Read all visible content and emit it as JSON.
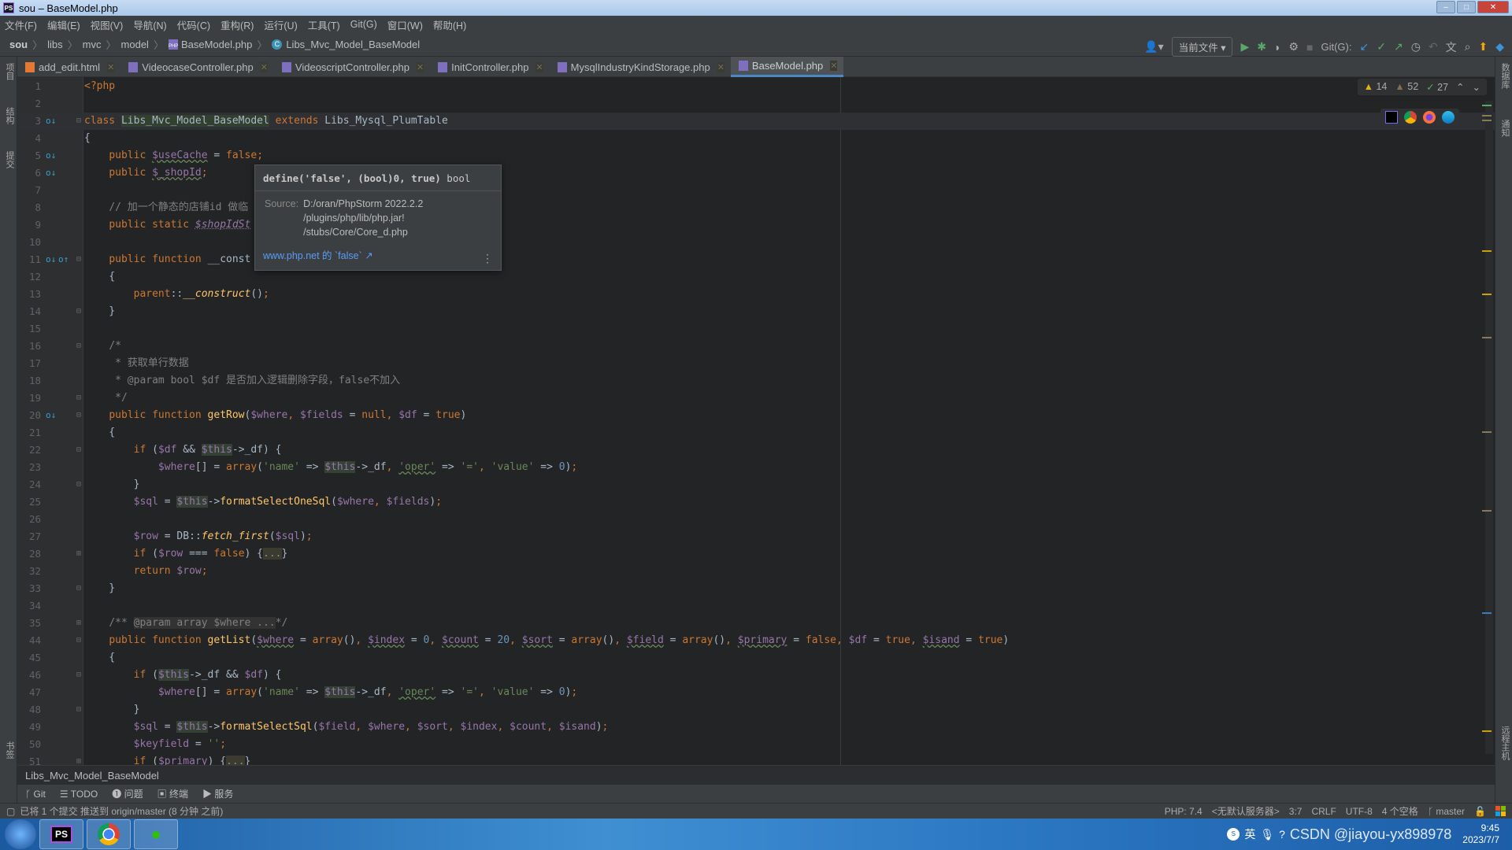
{
  "window": {
    "title": "sou – BaseModel.php"
  },
  "menu": [
    "文件(F)",
    "编辑(E)",
    "视图(V)",
    "导航(N)",
    "代码(C)",
    "重构(R)",
    "运行(U)",
    "工具(T)",
    "Git(G)",
    "窗口(W)",
    "帮助(H)"
  ],
  "breadcrumb": {
    "root": "sou",
    "parts": [
      "libs",
      "mvc",
      "model"
    ],
    "file": "BaseModel.php",
    "class": "Libs_Mvc_Model_BaseModel"
  },
  "toolbar": {
    "run_config": "当前文件",
    "git_label": "Git(G):"
  },
  "tabs": [
    {
      "label": "add_edit.html",
      "type": "html"
    },
    {
      "label": "VideocaseController.php",
      "type": "php"
    },
    {
      "label": "VideoscriptController.php",
      "type": "php"
    },
    {
      "label": "InitController.php",
      "type": "php"
    },
    {
      "label": "MysqlIndustryKindStorage.php",
      "type": "php"
    },
    {
      "label": "BaseModel.php",
      "type": "php",
      "active": true
    }
  ],
  "left_tools": [
    "项目",
    "结构",
    "提交",
    "书签"
  ],
  "right_tools": [
    "数据库",
    "通知",
    "远程主机"
  ],
  "inspections": {
    "warnings": "14",
    "weak_warnings": "52",
    "typos": "27"
  },
  "code": [
    {
      "n": "1",
      "t": [
        [
          "k",
          "<?php"
        ]
      ]
    },
    {
      "n": "2",
      "t": []
    },
    {
      "n": "3",
      "cur": true,
      "g": "o↓",
      "fold": "open",
      "t": [
        [
          "k",
          "class "
        ],
        [
          "hc",
          "Libs_Mvc_Model_BaseModel"
        ],
        [
          "k",
          " extends "
        ],
        [
          "",
          "Libs_Mysql_PlumTable"
        ]
      ]
    },
    {
      "n": "4",
      "t": [
        [
          "",
          "{"
        ]
      ]
    },
    {
      "n": "5",
      "g": "o↓",
      "t": [
        [
          "",
          "    "
        ],
        [
          "k",
          "public "
        ],
        [
          "v ul",
          "$useCache"
        ],
        [
          "",
          " = "
        ],
        [
          "k",
          "false"
        ],
        [
          "k",
          ";"
        ]
      ]
    },
    {
      "n": "6",
      "g": "o↓",
      "t": [
        [
          "",
          "    "
        ],
        [
          "k",
          "public "
        ],
        [
          "v ul",
          "$_shopId"
        ],
        [
          "k",
          ";"
        ]
      ]
    },
    {
      "n": "7",
      "t": []
    },
    {
      "n": "8",
      "t": [
        [
          "",
          "    "
        ],
        [
          "c",
          "// 加一个静态的店铺id 做临"
        ]
      ]
    },
    {
      "n": "9",
      "t": [
        [
          "",
          "    "
        ],
        [
          "k",
          "public static "
        ],
        [
          "vi",
          "$shopIdSt"
        ]
      ]
    },
    {
      "n": "10",
      "t": []
    },
    {
      "n": "11",
      "g": "o↓",
      "g2": "o↑",
      "fold": "open",
      "t": [
        [
          "",
          "    "
        ],
        [
          "k",
          "public function "
        ],
        [
          "",
          "__const"
        ]
      ]
    },
    {
      "n": "12",
      "t": [
        [
          "",
          "    {"
        ]
      ]
    },
    {
      "n": "13",
      "t": [
        [
          "",
          "        "
        ],
        [
          "k",
          "parent"
        ],
        [
          "",
          "::"
        ],
        [
          "fi",
          "__construct"
        ],
        [
          "",
          "()"
        ],
        [
          "k",
          ";"
        ]
      ]
    },
    {
      "n": "14",
      "fold": "close",
      "t": [
        [
          "",
          "    }"
        ]
      ]
    },
    {
      "n": "15",
      "t": []
    },
    {
      "n": "16",
      "fold": "open",
      "t": [
        [
          "",
          "    "
        ],
        [
          "c",
          "/*"
        ]
      ]
    },
    {
      "n": "17",
      "t": [
        [
          "c",
          "     * 获取单行数据"
        ]
      ]
    },
    {
      "n": "18",
      "t": [
        [
          "c",
          "     * @param bool $df 是否加入逻辑删除字段，false不加入"
        ]
      ]
    },
    {
      "n": "19",
      "fold": "close",
      "t": [
        [
          "c",
          "     */"
        ]
      ]
    },
    {
      "n": "20",
      "g": "o↓",
      "fold": "open",
      "t": [
        [
          "",
          "    "
        ],
        [
          "k",
          "public function "
        ],
        [
          "f",
          "getRow"
        ],
        [
          "",
          "("
        ],
        [
          "v",
          "$where"
        ],
        [
          "k",
          ", "
        ],
        [
          "v",
          "$fields"
        ],
        [
          "",
          " = "
        ],
        [
          "k",
          "null"
        ],
        [
          "k",
          ", "
        ],
        [
          "v",
          "$df"
        ],
        [
          "",
          " = "
        ],
        [
          "k",
          "true"
        ],
        [
          "",
          ")"
        ]
      ]
    },
    {
      "n": "21",
      "t": [
        [
          "",
          "    {"
        ]
      ]
    },
    {
      "n": "22",
      "fold": "open",
      "t": [
        [
          "",
          "        "
        ],
        [
          "k",
          "if "
        ],
        [
          "",
          "("
        ],
        [
          "v",
          "$df"
        ],
        [
          "",
          " && "
        ],
        [
          "h",
          "$this"
        ],
        [
          "",
          "->_df) {"
        ]
      ]
    },
    {
      "n": "23",
      "t": [
        [
          "",
          "            "
        ],
        [
          "v",
          "$where"
        ],
        [
          "",
          "[] = "
        ],
        [
          "k",
          "array"
        ],
        [
          "",
          "("
        ],
        [
          "s",
          "'name'"
        ],
        [
          "",
          " => "
        ],
        [
          "h",
          "$this"
        ],
        [
          "",
          "->_df"
        ],
        [
          "k",
          ", "
        ],
        [
          "s ul",
          "'oper'"
        ],
        [
          "",
          " => "
        ],
        [
          "s",
          "'='"
        ],
        [
          "k",
          ", "
        ],
        [
          "s",
          "'value'"
        ],
        [
          "",
          " => "
        ],
        [
          "n",
          "0"
        ],
        [
          "",
          ")"
        ],
        [
          "k",
          ";"
        ]
      ]
    },
    {
      "n": "24",
      "fold": "close",
      "t": [
        [
          "",
          "        }"
        ]
      ]
    },
    {
      "n": "25",
      "t": [
        [
          "",
          "        "
        ],
        [
          "v",
          "$sql"
        ],
        [
          "",
          " = "
        ],
        [
          "h",
          "$this"
        ],
        [
          "",
          "->"
        ],
        [
          "f",
          "formatSelectOneSql"
        ],
        [
          "",
          "("
        ],
        [
          "v",
          "$where"
        ],
        [
          "k",
          ", "
        ],
        [
          "v",
          "$fields"
        ],
        [
          "",
          ")"
        ],
        [
          "k",
          ";"
        ]
      ]
    },
    {
      "n": "26",
      "t": []
    },
    {
      "n": "27",
      "t": [
        [
          "",
          "        "
        ],
        [
          "v",
          "$row"
        ],
        [
          "",
          " = DB::"
        ],
        [
          "fi",
          "fetch_first"
        ],
        [
          "",
          "("
        ],
        [
          "v",
          "$sql"
        ],
        [
          "",
          ")"
        ],
        [
          "k",
          ";"
        ]
      ]
    },
    {
      "n": "28",
      "fold": "plus",
      "t": [
        [
          "",
          "        "
        ],
        [
          "k",
          "if "
        ],
        [
          "",
          "("
        ],
        [
          "v",
          "$row"
        ],
        [
          "",
          " === "
        ],
        [
          "k",
          "false"
        ],
        [
          "",
          ") {"
        ],
        [
          "x",
          "..."
        ],
        [
          "",
          "}"
        ]
      ]
    },
    {
      "n": "32",
      "t": [
        [
          "",
          "        "
        ],
        [
          "k",
          "return "
        ],
        [
          "v",
          "$row"
        ],
        [
          "k",
          ";"
        ]
      ]
    },
    {
      "n": "33",
      "fold": "close",
      "t": [
        [
          "",
          "    }"
        ]
      ]
    },
    {
      "n": "34",
      "t": []
    },
    {
      "n": "35",
      "fold": "plus",
      "t": [
        [
          "",
          "    "
        ],
        [
          "c",
          "/** "
        ],
        [
          "cx",
          "@param array $where ..."
        ],
        [
          "c",
          "*/"
        ]
      ]
    },
    {
      "n": "44",
      "fold": "open",
      "t": [
        [
          "",
          "    "
        ],
        [
          "k",
          "public function "
        ],
        [
          "f",
          "getList"
        ],
        [
          "",
          "("
        ],
        [
          "v ul",
          "$where"
        ],
        [
          "",
          " = "
        ],
        [
          "k",
          "array"
        ],
        [
          "",
          "()"
        ],
        [
          "k",
          ", "
        ],
        [
          "v ul",
          "$index"
        ],
        [
          "",
          " = "
        ],
        [
          "n",
          "0"
        ],
        [
          "k",
          ", "
        ],
        [
          "v ul",
          "$count"
        ],
        [
          "",
          " = "
        ],
        [
          "n",
          "20"
        ],
        [
          "k",
          ", "
        ],
        [
          "v ul",
          "$sort"
        ],
        [
          "",
          " = "
        ],
        [
          "k",
          "array"
        ],
        [
          "",
          "()"
        ],
        [
          "k",
          ", "
        ],
        [
          "v ul",
          "$field"
        ],
        [
          "",
          " = "
        ],
        [
          "k",
          "array"
        ],
        [
          "",
          "()"
        ],
        [
          "k",
          ", "
        ],
        [
          "v ul",
          "$primary"
        ],
        [
          "",
          " = "
        ],
        [
          "k",
          "false"
        ],
        [
          "k",
          ", "
        ],
        [
          "v",
          "$df"
        ],
        [
          "",
          " = "
        ],
        [
          "k",
          "true"
        ],
        [
          "k",
          ", "
        ],
        [
          "v ul",
          "$isand"
        ],
        [
          "",
          " = "
        ],
        [
          "k",
          "true"
        ],
        [
          "",
          ")"
        ]
      ]
    },
    {
      "n": "45",
      "t": [
        [
          "",
          "    {"
        ]
      ]
    },
    {
      "n": "46",
      "fold": "open",
      "t": [
        [
          "",
          "        "
        ],
        [
          "k",
          "if "
        ],
        [
          "",
          "("
        ],
        [
          "h",
          "$this"
        ],
        [
          "",
          "->_df && "
        ],
        [
          "v",
          "$df"
        ],
        [
          "",
          ") {"
        ]
      ]
    },
    {
      "n": "47",
      "t": [
        [
          "",
          "            "
        ],
        [
          "v",
          "$where"
        ],
        [
          "",
          "[] = "
        ],
        [
          "k",
          "array"
        ],
        [
          "",
          "("
        ],
        [
          "s",
          "'name'"
        ],
        [
          "",
          " => "
        ],
        [
          "h",
          "$this"
        ],
        [
          "",
          "->_df"
        ],
        [
          "k",
          ", "
        ],
        [
          "s ul",
          "'oper'"
        ],
        [
          "",
          " => "
        ],
        [
          "s",
          "'='"
        ],
        [
          "k",
          ", "
        ],
        [
          "s",
          "'value'"
        ],
        [
          "",
          " => "
        ],
        [
          "n",
          "0"
        ],
        [
          "",
          ")"
        ],
        [
          "k",
          ";"
        ]
      ]
    },
    {
      "n": "48",
      "fold": "close",
      "t": [
        [
          "",
          "        }"
        ]
      ]
    },
    {
      "n": "49",
      "t": [
        [
          "",
          "        "
        ],
        [
          "v",
          "$sql"
        ],
        [
          "",
          " = "
        ],
        [
          "h",
          "$this"
        ],
        [
          "",
          "->"
        ],
        [
          "f",
          "formatSelectSql"
        ],
        [
          "",
          "("
        ],
        [
          "v",
          "$field"
        ],
        [
          "k",
          ", "
        ],
        [
          "v",
          "$where"
        ],
        [
          "k",
          ", "
        ],
        [
          "v",
          "$sort"
        ],
        [
          "k",
          ", "
        ],
        [
          "v",
          "$index"
        ],
        [
          "k",
          ", "
        ],
        [
          "v",
          "$count"
        ],
        [
          "k",
          ", "
        ],
        [
          "v",
          "$isand"
        ],
        [
          "",
          ")"
        ],
        [
          "k",
          ";"
        ]
      ]
    },
    {
      "n": "50",
      "t": [
        [
          "",
          "        "
        ],
        [
          "v",
          "$keyfield"
        ],
        [
          "",
          " = "
        ],
        [
          "s",
          "''"
        ],
        [
          "k",
          ";"
        ]
      ]
    },
    {
      "n": "51",
      "fold": "plus",
      "t": [
        [
          "",
          "        "
        ],
        [
          "k",
          "if "
        ],
        [
          "",
          "("
        ],
        [
          "v",
          "$primary"
        ],
        [
          "",
          ") {"
        ],
        [
          "x",
          "..."
        ],
        [
          "",
          "}"
        ]
      ]
    }
  ],
  "tooltip": {
    "signature": "define('false', (bool)0, true)",
    "type": " bool",
    "source_label": "Source:",
    "source_lines": [
      "D:/oran/PhpStorm 2022.2.2",
      "/plugins/php/lib/php.jar!",
      "/stubs/Core/Core_d.php"
    ],
    "link": "www.php.net 的 `false` ↗"
  },
  "bottom_breadcrumb": "Libs_Mvc_Model_BaseModel",
  "tool_windows": [
    {
      "icon": "git-icon",
      "glyph": "ᚴ",
      "label": "Git"
    },
    {
      "icon": "todo-icon",
      "glyph": "☰",
      "label": "TODO"
    },
    {
      "icon": "problems-icon",
      "glyph": "❶",
      "label": "问题"
    },
    {
      "icon": "terminal-icon",
      "glyph": "▣",
      "label": "终端"
    },
    {
      "icon": "services-icon",
      "glyph": "▶",
      "label": "服务"
    }
  ],
  "status": {
    "message": "已将 1 个提交 推送到 origin/master (8 分钟 之前)",
    "php": "PHP: 7.4",
    "server": "<无默认服务器>",
    "position": "3:7",
    "line_sep": "CRLF",
    "encoding": "UTF-8",
    "indent": "4 个空格",
    "branch": "master"
  },
  "taskbar": {
    "apps": [
      "PS",
      "chrome",
      "wechat"
    ],
    "ime": "英",
    "watermark": "CSDN @jiayou-yx898978",
    "time": "9:45",
    "date": "2023/7/7"
  },
  "colors": {
    "accent": "#4a88c7",
    "keyword": "#cc7832",
    "variable": "#9876aa",
    "string": "#6a8759",
    "function": "#ffc66d",
    "link": "#589df6"
  }
}
